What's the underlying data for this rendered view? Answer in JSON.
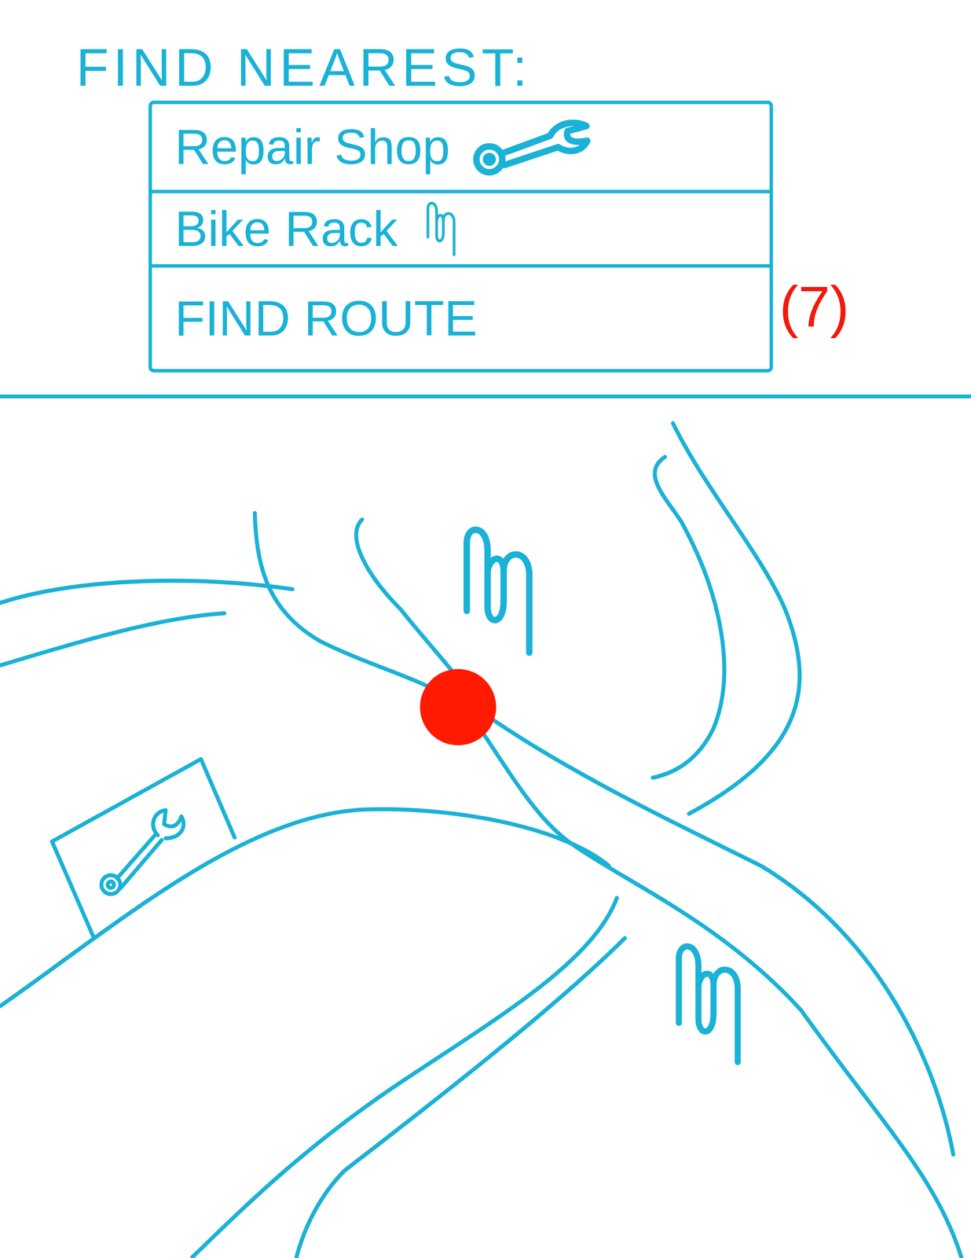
{
  "title": "FIND NEAREST:",
  "menu": {
    "items": [
      {
        "label": "Repair Shop",
        "kind": "repair"
      },
      {
        "label": "Bike Rack",
        "kind": "rack"
      },
      {
        "label": "FIND ROUTE",
        "kind": "route"
      }
    ],
    "badge": "(7)"
  },
  "map": {
    "markers": [
      {
        "kind": "rack"
      },
      {
        "kind": "rack"
      },
      {
        "kind": "repair"
      }
    ]
  }
}
